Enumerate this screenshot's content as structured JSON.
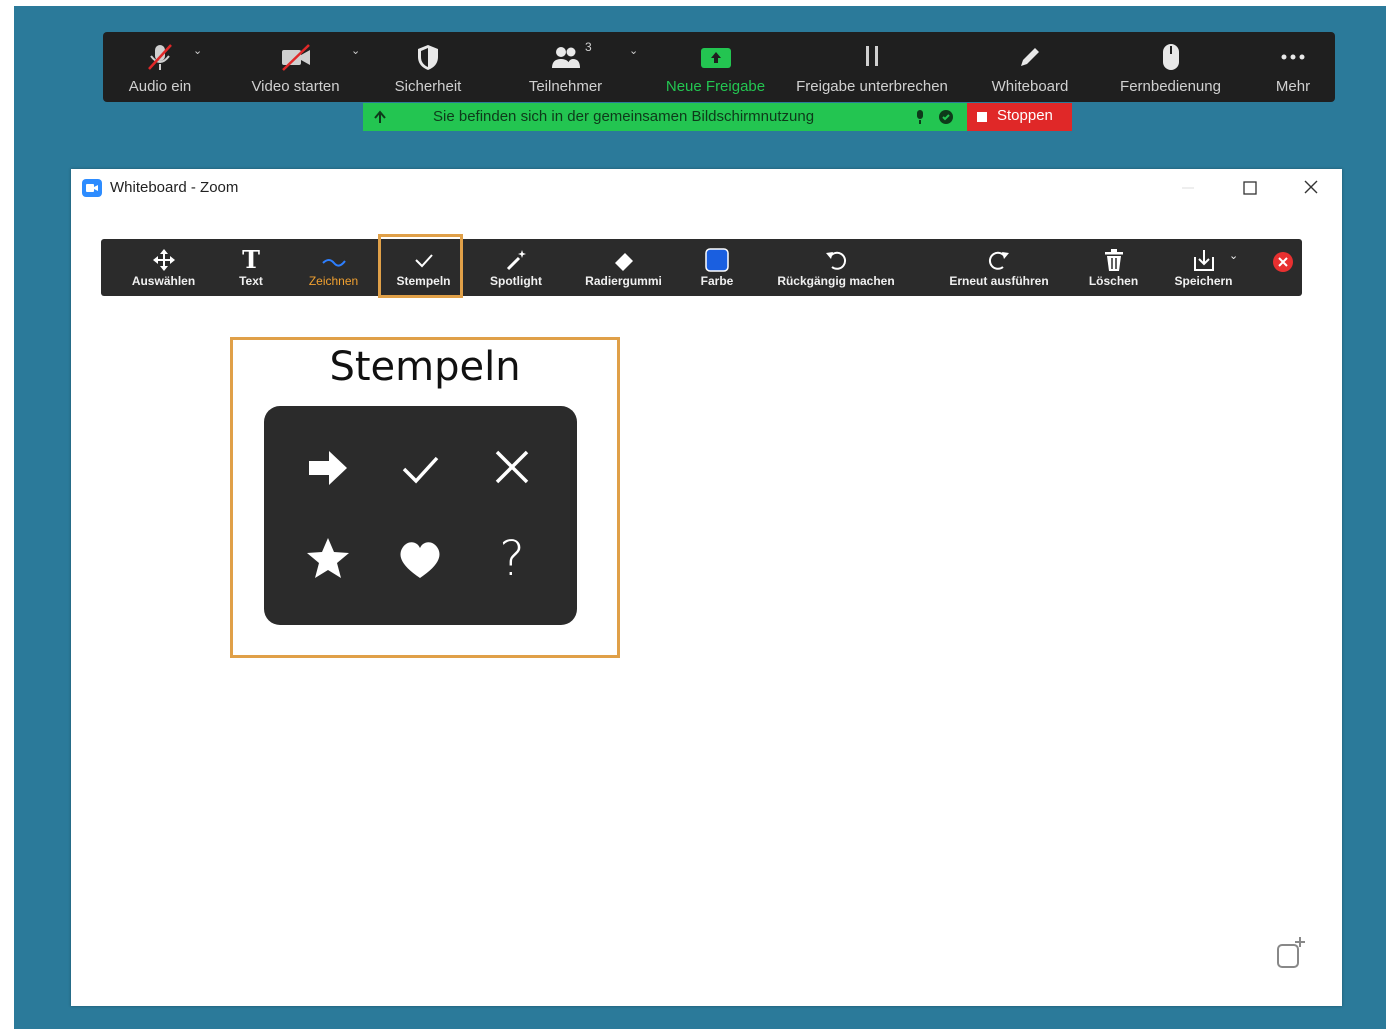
{
  "zoom_bar": {
    "items": [
      {
        "label": "Audio ein",
        "icon": "microphone-muted-icon"
      },
      {
        "label": "Video starten",
        "icon": "video-off-icon"
      },
      {
        "label": "Sicherheit",
        "icon": "shield-icon"
      },
      {
        "label": "Teilnehmer",
        "icon": "participants-icon",
        "count": "3"
      },
      {
        "label": "Neue Freigabe",
        "icon": "share-screen-icon"
      },
      {
        "label": "Freigabe unterbrechen",
        "icon": "pause-icon"
      },
      {
        "label": "Whiteboard",
        "icon": "pencil-icon"
      },
      {
        "label": "Fernbedienung",
        "icon": "mouse-icon"
      },
      {
        "label": "Mehr",
        "icon": "more-dots-icon"
      }
    ],
    "accent_color": "#23c551"
  },
  "share_banner": {
    "text": "Sie befinden sich in der gemeinsamen Bildschirmnutzung",
    "stop_label": "Stoppen"
  },
  "window": {
    "title": "Whiteboard - Zoom"
  },
  "whiteboard_toolbar": {
    "items": [
      {
        "label": "Auswählen",
        "icon": "move-arrows-icon"
      },
      {
        "label": "Text",
        "icon": "text-icon"
      },
      {
        "label": "Zeichnen",
        "icon": "draw-line-icon"
      },
      {
        "label": "Stempeln",
        "icon": "checkmark-icon"
      },
      {
        "label": "Spotlight",
        "icon": "magic-wand-icon"
      },
      {
        "label": "Radiergummi",
        "icon": "eraser-icon"
      },
      {
        "label": "Farbe",
        "icon": "color-square-icon"
      },
      {
        "label": "Rückgängig machen",
        "icon": "undo-icon"
      },
      {
        "label": "Erneut ausführen",
        "icon": "redo-icon"
      },
      {
        "label": "Löschen",
        "icon": "trash-icon"
      },
      {
        "label": "Speichern",
        "icon": "save-icon"
      }
    ],
    "active": "Stempeln",
    "color_value": "#1a5fe0",
    "highlight_color": "#e0a048"
  },
  "callout": {
    "title": "Stempeln",
    "stamps": [
      "arrow-right-icon",
      "checkmark-icon",
      "x-mark-icon",
      "star-icon",
      "heart-icon",
      "question-mark-icon"
    ]
  }
}
